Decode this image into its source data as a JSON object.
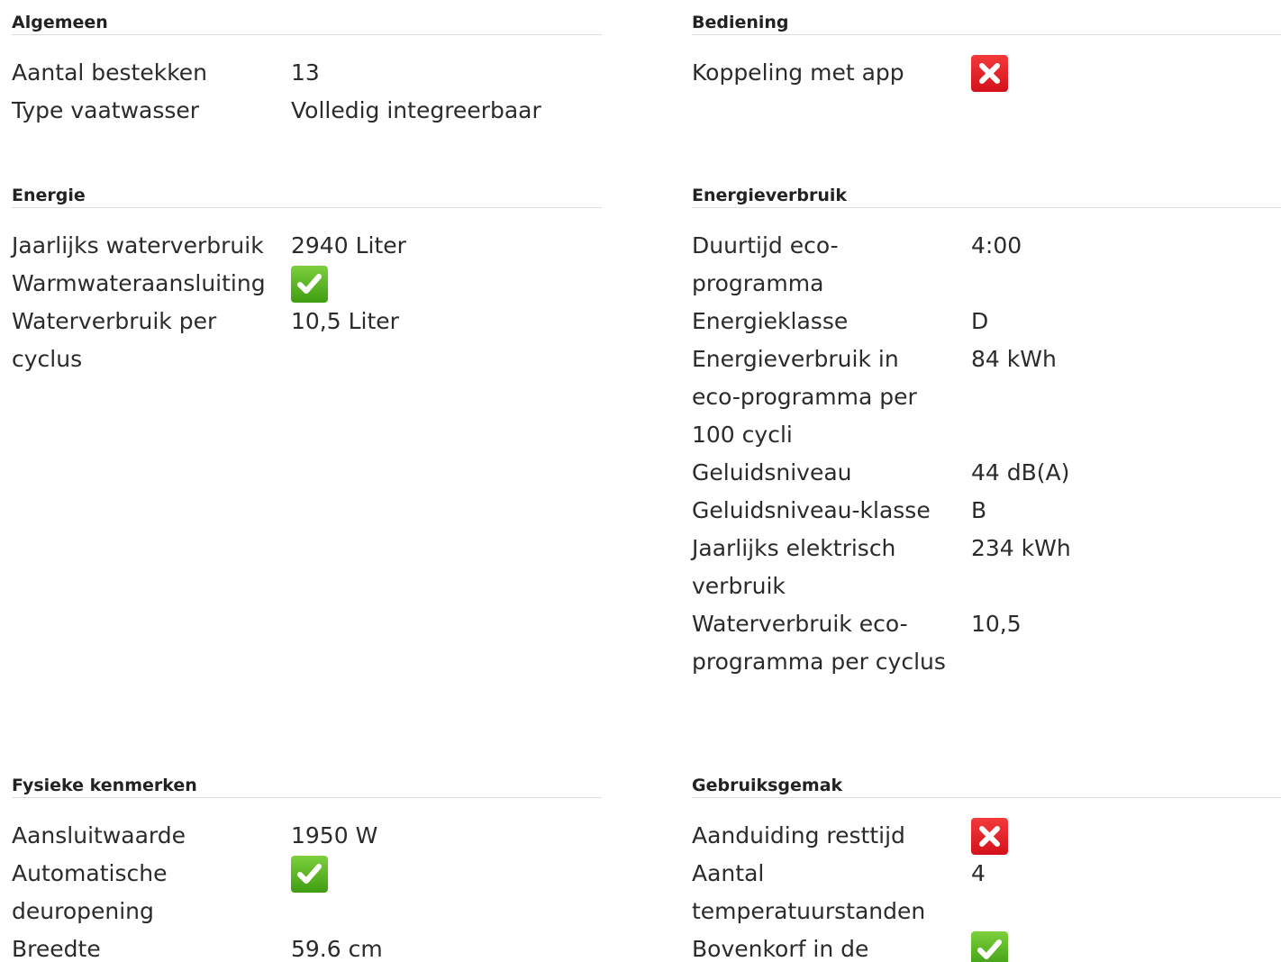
{
  "sections": {
    "algemeen": {
      "title": "Algemeen",
      "rows": [
        {
          "label": "Aantal bestekken",
          "value": "13"
        },
        {
          "label": "Type vaatwasser",
          "value": "Volledig integreerbaar"
        }
      ]
    },
    "bediening": {
      "title": "Bediening",
      "rows": [
        {
          "label": "Koppeling met app",
          "icon": "cross-icon"
        }
      ]
    },
    "energie": {
      "title": "Energie",
      "rows": [
        {
          "label": "Jaarlijks waterverbruik",
          "value": "2940 Liter"
        },
        {
          "label": "Warmwateraansluiting",
          "icon": "check-icon"
        },
        {
          "label": "Waterverbruik per cyclus",
          "value": "10,5 Liter"
        }
      ]
    },
    "energieverbruik": {
      "title": "Energieverbruik",
      "rows": [
        {
          "label": "Duurtijd eco-programma",
          "value": "4:00"
        },
        {
          "label": "Energieklasse",
          "value": "D"
        },
        {
          "label": "Energieverbruik in eco-programma per 100 cycli",
          "value": "84 kWh"
        },
        {
          "label": "Geluidsniveau",
          "value": "44 dB(A)"
        },
        {
          "label": "Geluidsniveau-klasse",
          "value": "B"
        },
        {
          "label": "Jaarlijks elektrisch verbruik",
          "value": "234 kWh"
        },
        {
          "label": "Waterverbruik eco-programma per cyclus",
          "value": "10,5"
        }
      ]
    },
    "fysieke": {
      "title": "Fysieke kenmerken",
      "rows": [
        {
          "label": "Aansluitwaarde",
          "value": "1950 W"
        },
        {
          "label": "Automatische deuropening",
          "icon": "check-icon"
        },
        {
          "label": "Breedte",
          "value": "59.6 cm"
        }
      ]
    },
    "gebruiksgemak": {
      "title": "Gebruiksgemak",
      "rows": [
        {
          "label": "Aanduiding resttijd",
          "icon": "cross-icon"
        },
        {
          "label": "Aantal temperatuurstanden",
          "value": "4"
        },
        {
          "label": "Bovenkorf in de",
          "icon": "check-icon"
        }
      ]
    }
  },
  "colors": {
    "check": "#4caf1c",
    "cross": "#e5202b",
    "divider": "#dcdcdc"
  }
}
